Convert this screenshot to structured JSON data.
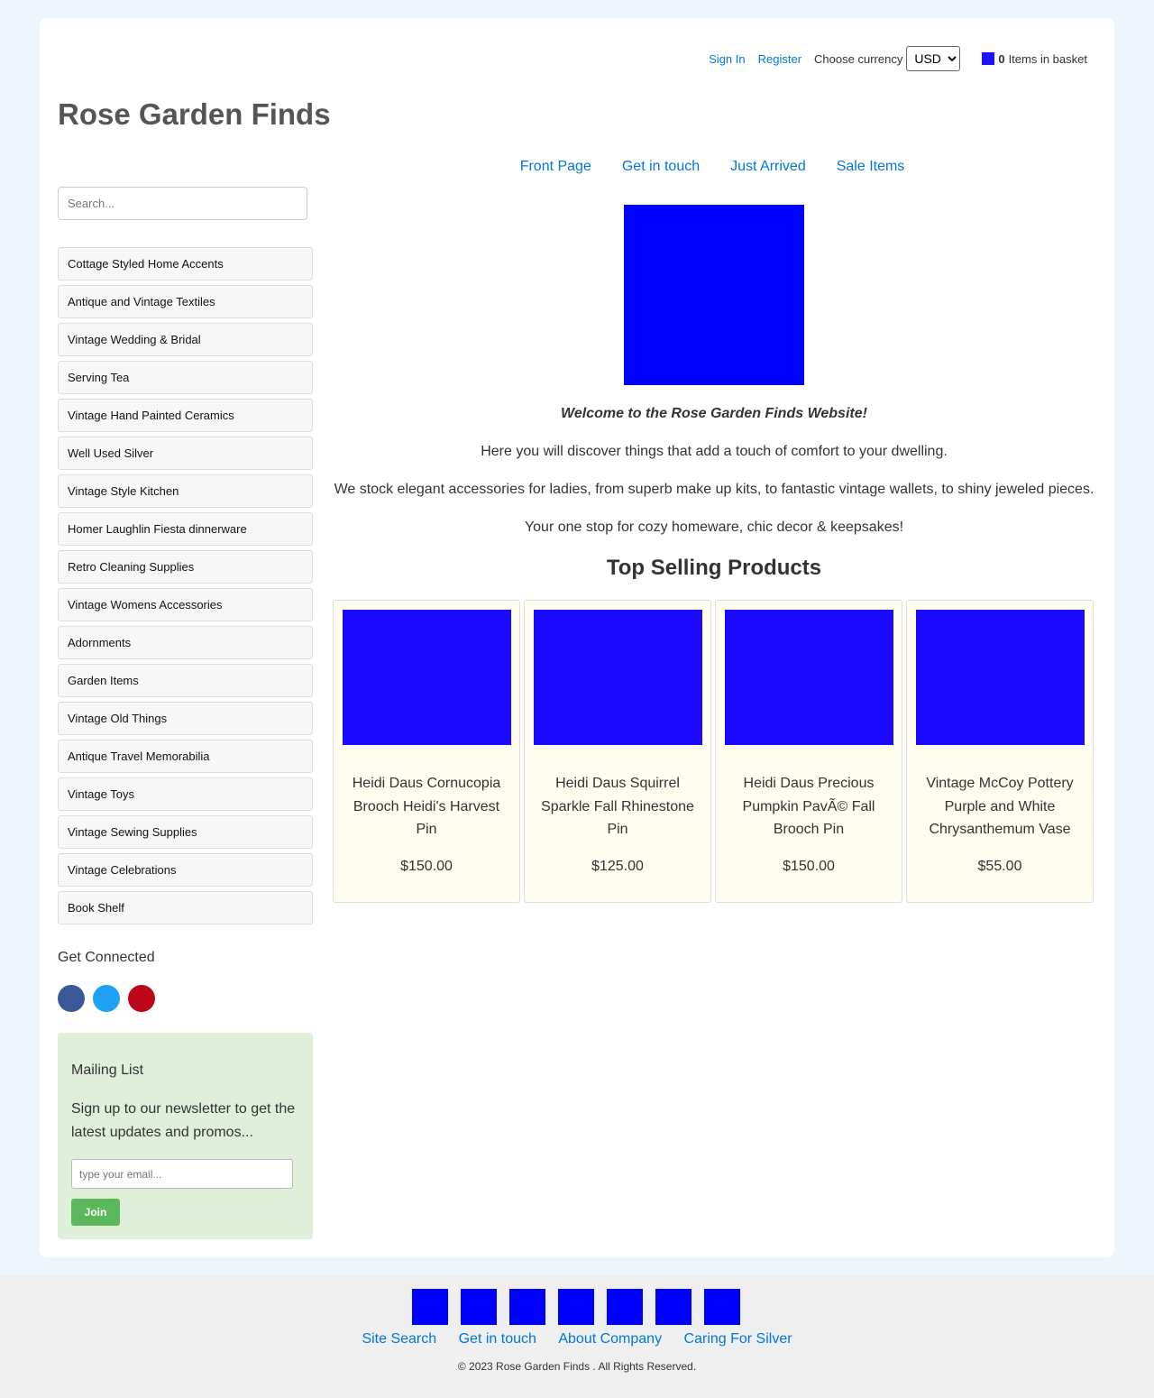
{
  "header": {
    "sign_in": "Sign In",
    "register": "Register",
    "currency_label": "Choose currency",
    "currency_value": "USD",
    "basket_count": "0",
    "basket_label": "Items in basket",
    "site_title": "Rose Garden Finds"
  },
  "nav": [
    "Front Page",
    "Get in touch",
    "Just Arrived",
    "Sale Items"
  ],
  "sidebar": {
    "search_placeholder": "Search...",
    "categories": [
      "Cottage Styled Home Accents",
      "Antique and Vintage Textiles",
      "Vintage Wedding & Bridal",
      "Serving Tea",
      "Vintage Hand Painted Ceramics",
      "Well Used Silver",
      "Vintage Style Kitchen",
      "Homer Laughlin Fiesta dinnerware",
      "Retro Cleaning Supplies",
      "Vintage Womens Accessories",
      "Adornments",
      "Garden Items",
      "Vintage Old Things",
      "Antique Travel Memorabilia",
      "Vintage Toys",
      "Vintage Sewing Supplies",
      "Vintage Celebrations",
      "Book Shelf"
    ],
    "connected_title": "Get Connected",
    "socials": [
      {
        "icon": "facebook-icon",
        "color": "#3b5998"
      },
      {
        "icon": "twitter-icon",
        "color": "#1da1f2"
      },
      {
        "icon": "pinterest-icon",
        "color": "#bd081c"
      }
    ],
    "mailing": {
      "title": "Mailing List",
      "text": "Sign up to our newsletter to get the latest updates and promos...",
      "placeholder": "type your email...",
      "button": "Join"
    }
  },
  "main": {
    "welcome_title": "Welcome to the Rose Garden Finds Website!",
    "line1": "Here you will discover things that add a touch of comfort to your dwelling.",
    "line2": "We stock elegant accessories for ladies, from superb make up kits, to fantastic vintage wallets, to shiny jeweled pieces.",
    "line3": "Your one stop for cozy homeware, chic decor & keepsakes!",
    "top_heading": "Top Selling Products",
    "products": [
      {
        "name": "Heidi Daus Cornucopia Brooch Heidi's Harvest Pin",
        "price": "$150.00"
      },
      {
        "name": "Heidi Daus Squirrel Sparkle Fall Rhinestone Pin",
        "price": "$125.00"
      },
      {
        "name": "Heidi Daus Precious Pumpkin PavÃ© Fall Brooch Pin",
        "price": "$150.00"
      },
      {
        "name": "Vintage McCoy Pottery Purple and White Chrysanthemum Vase",
        "price": "$55.00"
      }
    ]
  },
  "footer": {
    "links": [
      "Site Search",
      "Get in touch",
      "About Company",
      "Caring For Silver"
    ],
    "copyright": "© 2023 Rose Garden Finds . All Rights Reserved."
  },
  "colors": {
    "accent": "#0077dd",
    "placeholder_image": "#0000ff",
    "join_button": "#5cb85c",
    "mailing_bg": "#dfefd9"
  }
}
